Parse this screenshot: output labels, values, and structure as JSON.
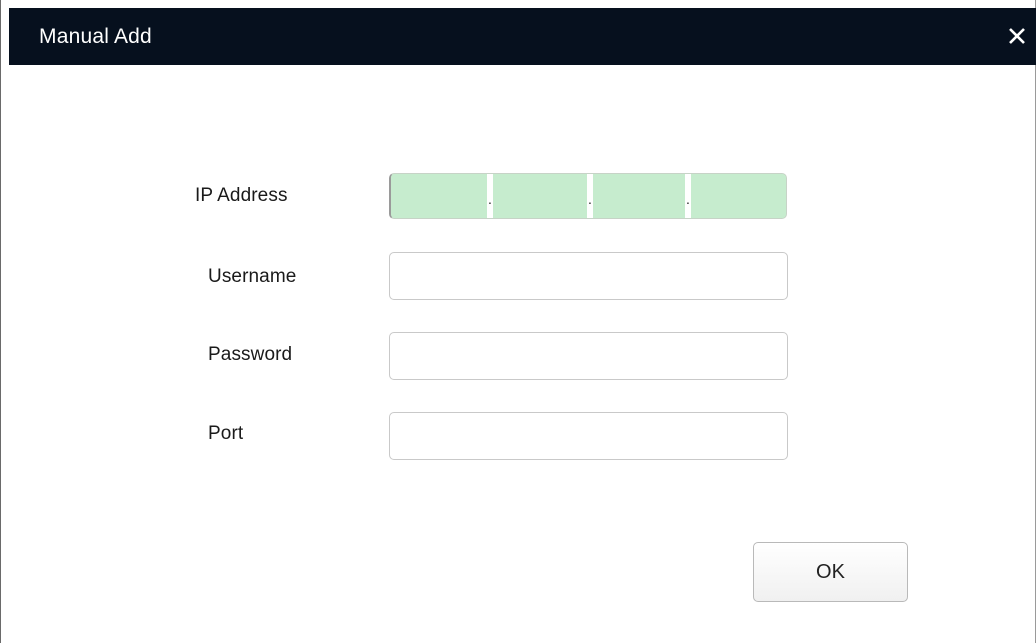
{
  "dialog": {
    "title": "Manual Add",
    "close_icon": "close-icon"
  },
  "form": {
    "ip_label": "IP Address",
    "ip_octets": [
      "",
      "",
      "",
      ""
    ],
    "ip_separator": ".",
    "username_label": "Username",
    "username_value": "",
    "password_label": "Password",
    "password_value": "",
    "port_label": "Port",
    "port_value": ""
  },
  "actions": {
    "ok_label": "OK"
  },
  "colors": {
    "titlebar": "#06101e",
    "ip_field_fill": "#c6ecce"
  }
}
